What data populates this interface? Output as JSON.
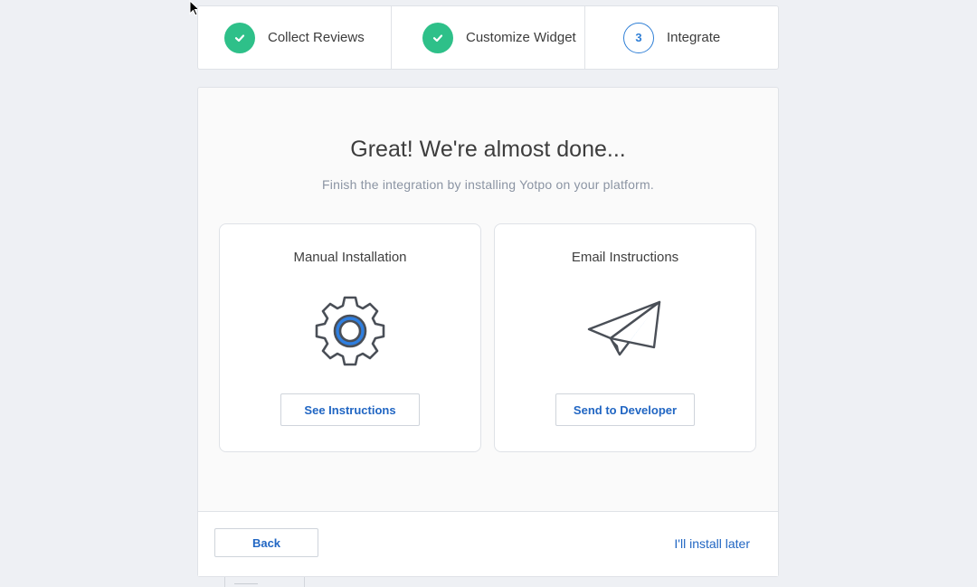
{
  "stepper": {
    "steps": [
      {
        "label": "Collect Reviews",
        "state": "done"
      },
      {
        "label": "Customize Widget",
        "state": "done"
      },
      {
        "label": "Integrate",
        "state": "current",
        "number": "3"
      }
    ]
  },
  "main": {
    "title": "Great! We're almost done...",
    "subtitle": "Finish the integration by installing Yotpo on your platform.",
    "cards": [
      {
        "title": "Manual Installation",
        "icon": "gear-icon",
        "button_label": "See Instructions"
      },
      {
        "title": "Email Instructions",
        "icon": "paper-plane-icon",
        "button_label": "Send to Developer"
      }
    ]
  },
  "footer": {
    "back_label": "Back",
    "later_label": "I'll install later"
  },
  "colors": {
    "accent": "#2166c3",
    "success": "#2ec089",
    "icon_blue": "#2f7fe0",
    "icon_gray": "#4a4f57"
  }
}
